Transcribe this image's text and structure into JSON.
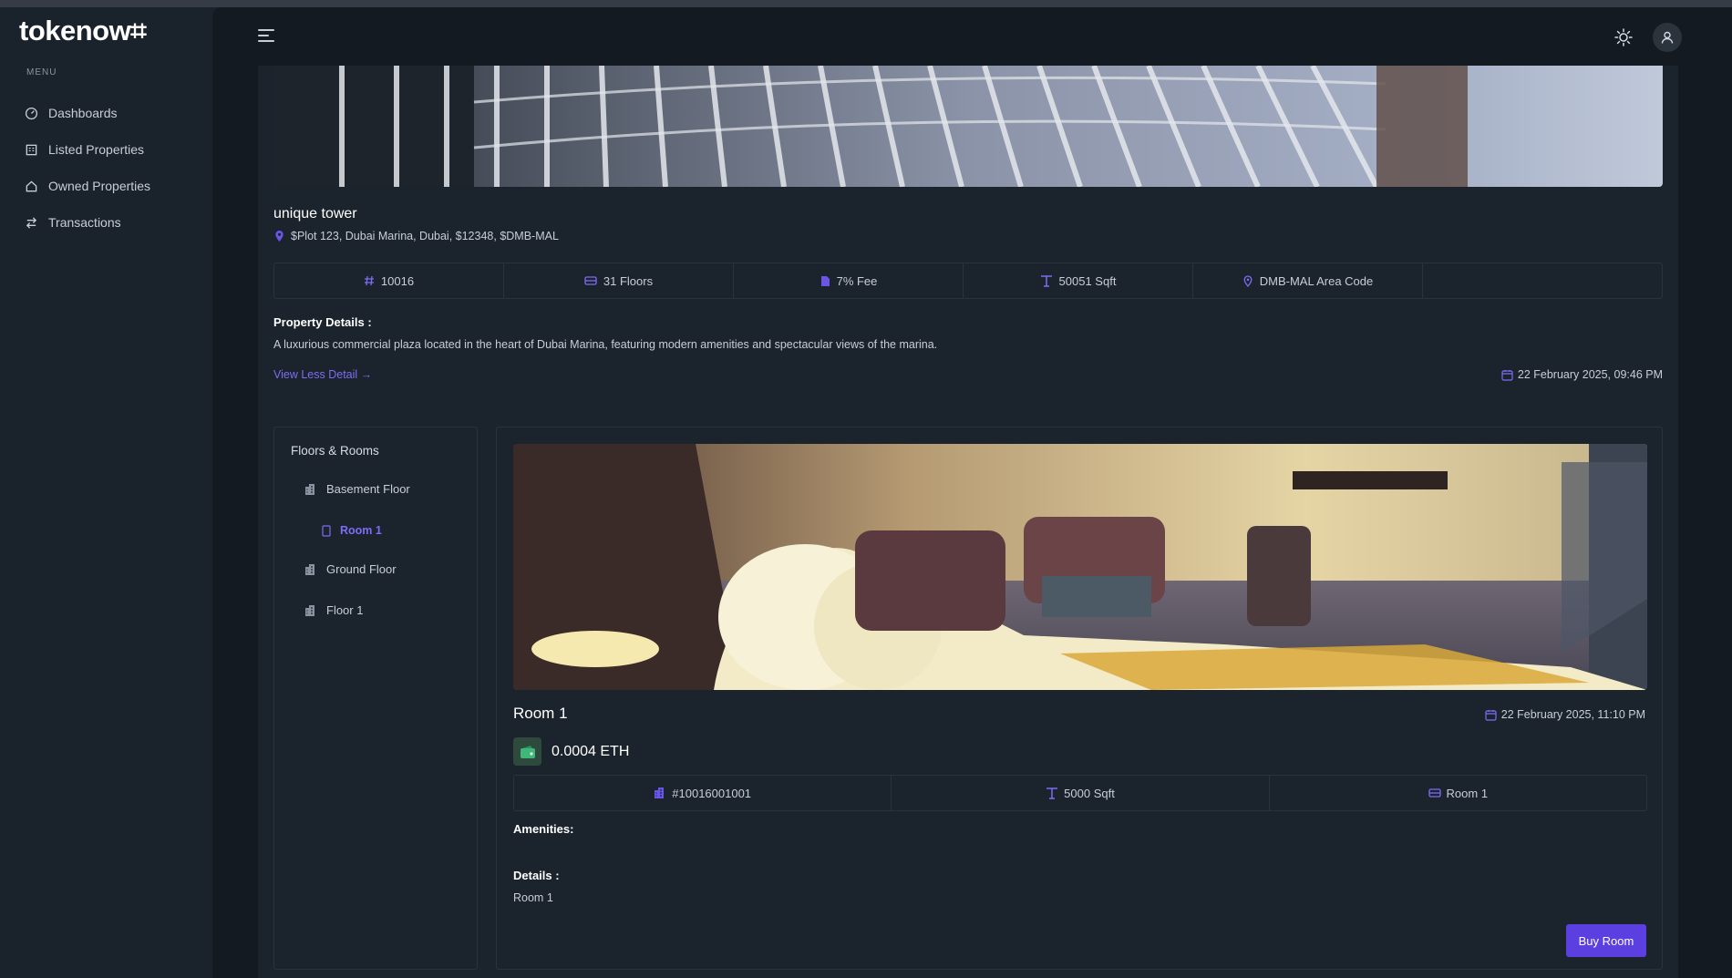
{
  "app": {
    "logo": "tokenow⌗"
  },
  "sidebar": {
    "menu_caption": "MENU",
    "items": [
      {
        "label": "Dashboards",
        "icon": "dashboard-icon"
      },
      {
        "label": "Listed Properties",
        "icon": "building-icon"
      },
      {
        "label": "Owned Properties",
        "icon": "home-icon"
      },
      {
        "label": "Transactions",
        "icon": "transfer-icon"
      }
    ]
  },
  "property": {
    "title": "unique tower",
    "address": "$Plot 123, Dubai Marina, Dubai, $12348, $DMB-MAL",
    "stats": [
      {
        "label": "10016",
        "icon": "hash-icon"
      },
      {
        "label": "31 Floors",
        "icon": "floors-icon"
      },
      {
        "label": "7% Fee",
        "icon": "document-icon"
      },
      {
        "label": "50051 Sqft",
        "icon": "area-icon"
      },
      {
        "label": "DMB-MAL Area Code",
        "icon": "location-icon"
      }
    ],
    "details_label": "Property Details :",
    "details_text": "A luxurious commercial plaza located in the heart of Dubai Marina, featuring modern amenities and spectacular views of the marina.",
    "view_less": "View Less Detail →",
    "date": "22 February 2025, 09:46 PM"
  },
  "floors": {
    "title": "Floors & Rooms",
    "items": [
      {
        "label": "Basement Floor"
      },
      {
        "label": "Ground Floor"
      },
      {
        "label": "Floor 1"
      }
    ],
    "selected_room": "Room 1"
  },
  "room": {
    "title": "Room 1",
    "date": "22 February 2025, 11:10 PM",
    "price": "0.0004 ETH",
    "stats": [
      {
        "label": "#10016001001",
        "icon": "building-icon"
      },
      {
        "label": "5000 Sqft",
        "icon": "area-icon"
      },
      {
        "label": "Room 1",
        "icon": "room-icon"
      }
    ],
    "amenities_label": "Amenities:",
    "details_label": "Details :",
    "details_text": "Room 1",
    "buy_label": "Buy Room"
  },
  "colors": {
    "accent": "#5b3fe0",
    "link": "#7e6df2",
    "background": "#131a22",
    "panel": "#1b232d"
  }
}
